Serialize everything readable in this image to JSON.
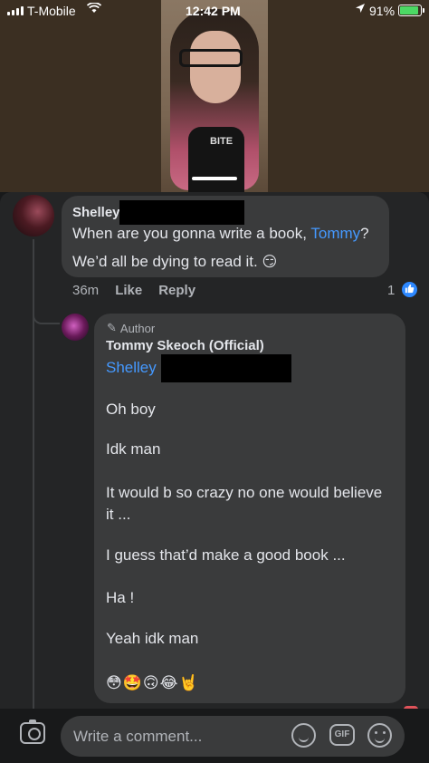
{
  "status_bar": {
    "carrier": "T-Mobile",
    "time": "12:42 PM",
    "battery": "91%",
    "battery_level": 0.91,
    "icons": [
      "signal-icon",
      "wifi-icon",
      "location-arrow-icon",
      "battery-charging-icon"
    ]
  },
  "video": {
    "shirt_text": "BITE"
  },
  "comment": {
    "author": "Shelley",
    "text_line1_prefix": "When are you gonna write a book, ",
    "mention": "Tommy",
    "text_line1_suffix": "?",
    "text_line2": "We’d all be dying to read it.",
    "emoji": "😏",
    "time": "36m",
    "like_label": "Like",
    "reply_label": "Reply",
    "reaction_count": "1",
    "reaction_icon": "thumbs-up-icon"
  },
  "reply": {
    "badge": "Author",
    "author": "Tommy Skeoch (Official)",
    "mention": "Shelley",
    "lines": [
      "Oh boy",
      "Idk man",
      "It would b so crazy no one would believe",
      "it ...",
      "I guess that’d make a good book ...",
      "Ha !",
      "Yeah idk man"
    ],
    "emojis": "😳🤩🙃😂🤘"
  },
  "composer": {
    "placeholder": "Write a comment...",
    "gif_label": "GIF",
    "icons": [
      "camera-icon",
      "avatar-sticker-icon",
      "gif-icon",
      "emoji-icon"
    ]
  },
  "colors": {
    "background": "#18191a",
    "panel": "#242526",
    "bubble": "#3a3b3c",
    "link": "#4599ff",
    "like_blue": "#2d88ff"
  }
}
